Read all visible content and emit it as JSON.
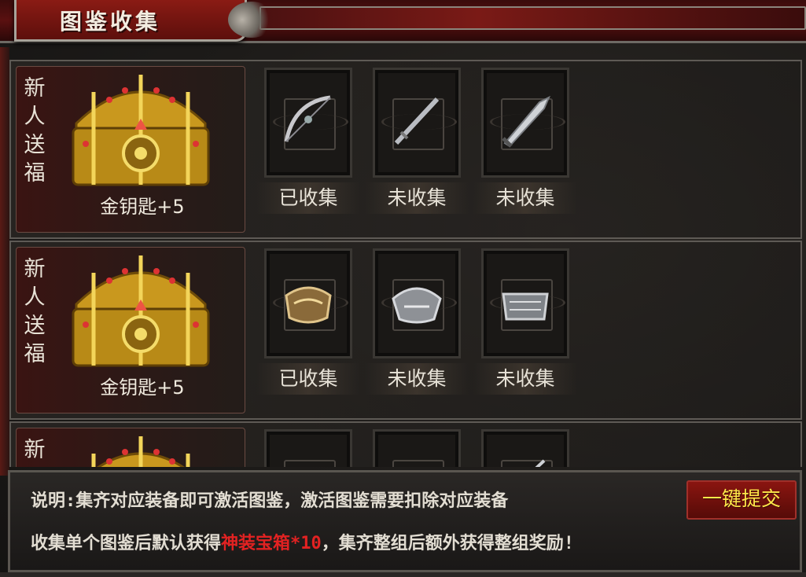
{
  "header": {
    "title": "图鉴收集"
  },
  "rows": [
    {
      "reward_label": "新人送福",
      "reward_text": "金钥匙+5",
      "slots": [
        {
          "item_icon": "bow-icon",
          "status": "已收集"
        },
        {
          "item_icon": "sword-icon",
          "status": "未收集"
        },
        {
          "item_icon": "blade-icon",
          "status": "未收集"
        }
      ]
    },
    {
      "reward_label": "新人送福",
      "reward_text": "金钥匙+5",
      "slots": [
        {
          "item_icon": "gold-armor-icon",
          "status": "已收集"
        },
        {
          "item_icon": "silver-armor-icon",
          "status": "未收集"
        },
        {
          "item_icon": "steel-armor-icon",
          "status": "未收集"
        }
      ]
    },
    {
      "reward_label": "新人送福",
      "reward_text": "",
      "slots": [
        {
          "item_icon": "jade-necklace-icon",
          "status": ""
        },
        {
          "item_icon": "gold-necklace-icon",
          "status": ""
        },
        {
          "item_icon": "dagger-icon",
          "status": ""
        }
      ]
    }
  ],
  "info": {
    "line1": "说明:集齐对应装备即可激活图鉴，激活图鉴需要扣除对应装备",
    "line2_prefix": "收集单个图鉴后默认获得",
    "line2_highlight": "神装宝箱*10",
    "line2_suffix": "，集齐整组后额外获得整组奖励!",
    "submit_label": "一键提交"
  },
  "colors": {
    "highlight": "#e22222",
    "button_text": "#ffe84a",
    "header_red": "#8a1b14"
  }
}
